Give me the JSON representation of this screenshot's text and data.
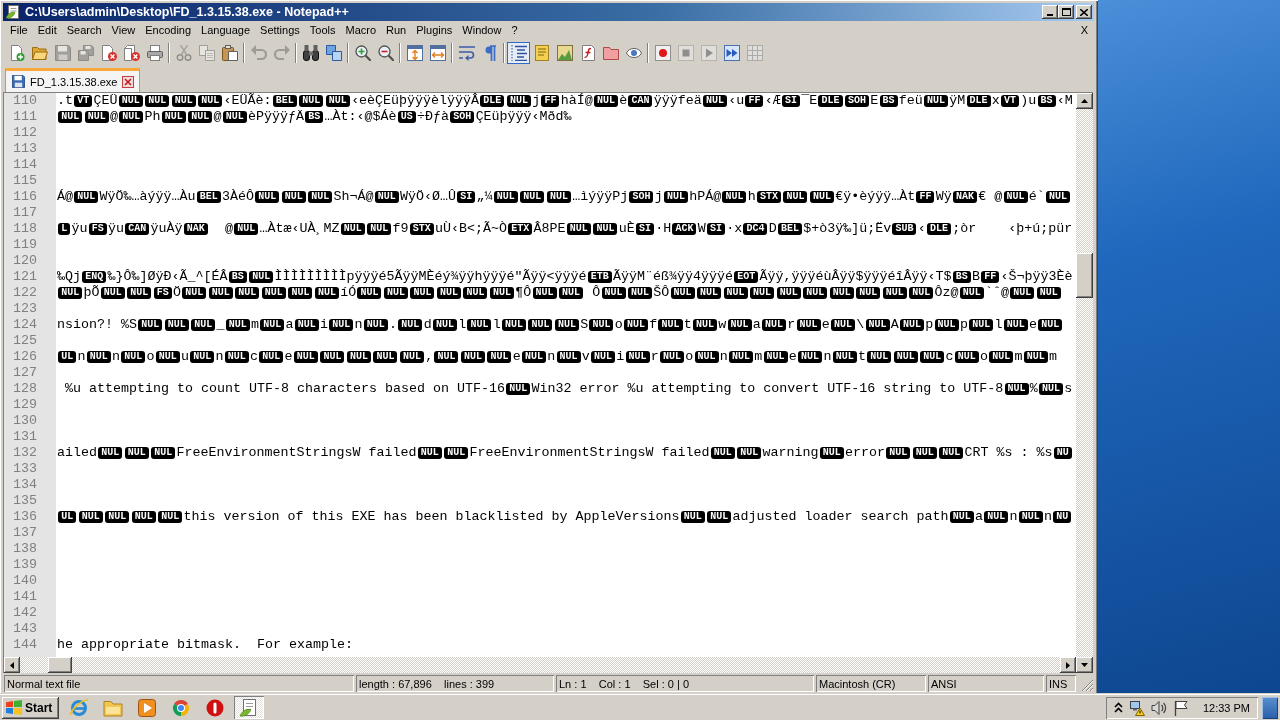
{
  "window": {
    "title": "C:\\Users\\admin\\Desktop\\FD_1.3.15.38.exe - Notepad++"
  },
  "menu": {
    "items": [
      "File",
      "Edit",
      "Search",
      "View",
      "Encoding",
      "Language",
      "Settings",
      "Tools",
      "Macro",
      "Run",
      "Plugins",
      "Window",
      "?"
    ],
    "close": "X"
  },
  "toolbar": [
    {
      "pressed": false,
      "disabled": false
    },
    {
      "pressed": false,
      "disabled": false
    },
    {
      "pressed": false,
      "disabled": true
    },
    {
      "pressed": false,
      "disabled": true
    },
    {
      "pressed": false,
      "disabled": false
    },
    {
      "pressed": false,
      "disabled": false
    },
    {
      "pressed": false,
      "disabled": false
    },
    {
      "pressed": false,
      "disabled": true
    },
    {
      "pressed": false,
      "disabled": true
    },
    {
      "pressed": false,
      "disabled": false
    },
    {
      "pressed": false,
      "disabled": true
    },
    {
      "pressed": false,
      "disabled": true
    },
    {
      "pressed": false,
      "disabled": false
    },
    {
      "pressed": false,
      "disabled": false
    },
    {
      "pressed": false,
      "disabled": false
    },
    {
      "pressed": false,
      "disabled": false
    },
    {
      "pressed": false,
      "disabled": false
    },
    {
      "pressed": false,
      "disabled": false
    },
    {
      "pressed": false,
      "disabled": false
    },
    {
      "pressed": false,
      "disabled": false
    },
    {
      "pressed": true,
      "disabled": false
    },
    {
      "pressed": false,
      "disabled": false
    },
    {
      "pressed": false,
      "disabled": false
    },
    {
      "pressed": false,
      "disabled": false
    },
    {
      "pressed": false,
      "disabled": false
    },
    {
      "pressed": false,
      "disabled": false
    },
    {
      "pressed": false,
      "disabled": false
    },
    {
      "pressed": false,
      "disabled": true
    },
    {
      "pressed": false,
      "disabled": true
    },
    {
      "pressed": false,
      "disabled": false
    },
    {
      "pressed": false,
      "disabled": true
    }
  ],
  "tabs": [
    {
      "label": "FD_1.3.15.38.exe",
      "selected": true,
      "modified": false
    }
  ],
  "editor": {
    "lines": [
      {
        "number": "110",
        "segments": [
          {
            "kind": "text",
            "text": ".t"
          },
          {
            "kind": "control",
            "text": "VT"
          },
          {
            "kind": "text",
            "text": "ÇEÜ"
          },
          {
            "kind": "control",
            "text": "NUL"
          },
          {
            "kind": "control",
            "text": "NUL"
          },
          {
            "kind": "control",
            "text": "NUL"
          },
          {
            "kind": "control",
            "text": "NUL"
          },
          {
            "kind": "text",
            "text": "‹EÜÃè:"
          },
          {
            "kind": "control",
            "text": "BEL"
          },
          {
            "kind": "control",
            "text": "NUL"
          },
          {
            "kind": "control",
            "text": "NUL"
          },
          {
            "kind": "text",
            "text": "‹eèÇEüþÿÿÿèlÿÿÿÂ"
          },
          {
            "kind": "control",
            "text": "DLE"
          },
          {
            "kind": "control",
            "text": "NUL"
          },
          {
            "kind": "text",
            "text": "j"
          },
          {
            "kind": "control",
            "text": "FF"
          },
          {
            "kind": "text",
            "text": "hàÍ@"
          },
          {
            "kind": "control",
            "text": "NUL"
          },
          {
            "kind": "text",
            "text": "è"
          },
          {
            "kind": "control",
            "text": "CAN"
          },
          {
            "kind": "text",
            "text": "ÿÿÿfeä"
          },
          {
            "kind": "control",
            "text": "NUL"
          },
          {
            "kind": "text",
            "text": "‹u"
          },
          {
            "kind": "control",
            "text": "FF"
          },
          {
            "kind": "text",
            "text": "‹Æ"
          },
          {
            "kind": "control",
            "text": "SI"
          },
          {
            "kind": "text",
            "text": "¯E"
          },
          {
            "kind": "control",
            "text": "DLE"
          },
          {
            "kind": "control",
            "text": "SOH"
          },
          {
            "kind": "text",
            "text": "E"
          },
          {
            "kind": "control",
            "text": "BS"
          },
          {
            "kind": "text",
            "text": "feü"
          },
          {
            "kind": "control",
            "text": "NUL"
          },
          {
            "kind": "text",
            "text": "ÿM"
          },
          {
            "kind": "control",
            "text": "DLE"
          },
          {
            "kind": "text",
            "text": "x"
          },
          {
            "kind": "control",
            "text": "VT"
          },
          {
            "kind": "text",
            "text": ")u"
          },
          {
            "kind": "control",
            "text": "BS"
          },
          {
            "kind": "text",
            "text": "‹M"
          }
        ]
      },
      {
        "number": "111",
        "segments": [
          {
            "kind": "control",
            "text": "NUL"
          },
          {
            "kind": "control",
            "text": "NUL"
          },
          {
            "kind": "text",
            "text": "@"
          },
          {
            "kind": "control",
            "text": "NUL"
          },
          {
            "kind": "text",
            "text": "Ph"
          },
          {
            "kind": "control",
            "text": "NUL"
          },
          {
            "kind": "control",
            "text": "NUL"
          },
          {
            "kind": "text",
            "text": "@"
          },
          {
            "kind": "control",
            "text": "NUL"
          },
          {
            "kind": "text",
            "text": "èPÿÿÿƒÄ"
          },
          {
            "kind": "control",
            "text": "BS"
          },
          {
            "kind": "text",
            "text": "…Àt:‹@$Áè"
          },
          {
            "kind": "control",
            "text": "US"
          },
          {
            "kind": "text",
            "text": "÷Ðƒà"
          },
          {
            "kind": "control",
            "text": "SOH"
          },
          {
            "kind": "text",
            "text": "ÇEüþÿÿÿ‹Mðd‰"
          }
        ]
      },
      {
        "number": "112"
      },
      {
        "number": "113"
      },
      {
        "number": "114"
      },
      {
        "number": "115"
      },
      {
        "number": "116",
        "segments": [
          {
            "kind": "text",
            "text": "Á@"
          },
          {
            "kind": "control",
            "text": "NUL"
          },
          {
            "kind": "text",
            "text": "WÿÖ‰…àýÿÿ…Àu"
          },
          {
            "kind": "control",
            "text": "BEL"
          },
          {
            "kind": "text",
            "text": "3ÀéÔ"
          },
          {
            "kind": "control",
            "text": "NUL"
          },
          {
            "kind": "control",
            "text": "NUL"
          },
          {
            "kind": "control",
            "text": "NUL"
          },
          {
            "kind": "text",
            "text": "Sh¬Á@"
          },
          {
            "kind": "control",
            "text": "NUL"
          },
          {
            "kind": "text",
            "text": "WÿÖ‹Ø…Û"
          },
          {
            "kind": "control",
            "text": "SI"
          },
          {
            "kind": "text",
            "text": "„¼"
          },
          {
            "kind": "control",
            "text": "NUL"
          },
          {
            "kind": "control",
            "text": "NUL"
          },
          {
            "kind": "control",
            "text": "NUL"
          },
          {
            "kind": "text",
            "text": "…ìýÿÿPj"
          },
          {
            "kind": "control",
            "text": "SOH"
          },
          {
            "kind": "text",
            "text": "j"
          },
          {
            "kind": "control",
            "text": "NUL"
          },
          {
            "kind": "text",
            "text": "hPÁ@"
          },
          {
            "kind": "control",
            "text": "NUL"
          },
          {
            "kind": "text",
            "text": "h"
          },
          {
            "kind": "control",
            "text": "STX"
          },
          {
            "kind": "control",
            "text": "NUL"
          },
          {
            "kind": "control",
            "text": "NUL"
          },
          {
            "kind": "text",
            "text": "€ÿ•èýÿÿ…Àt"
          },
          {
            "kind": "control",
            "text": "FF"
          },
          {
            "kind": "text",
            "text": "Wÿ"
          },
          {
            "kind": "control",
            "text": "NAK"
          },
          {
            "kind": "text",
            "text": "€ @"
          },
          {
            "kind": "control",
            "text": "NUL"
          },
          {
            "kind": "text",
            "text": "é`"
          },
          {
            "kind": "control",
            "text": "NUL"
          }
        ]
      },
      {
        "number": "117"
      },
      {
        "number": "118",
        "segments": [
          {
            "kind": "control",
            "text": "L"
          },
          {
            "kind": "text",
            "text": "ÿu"
          },
          {
            "kind": "control",
            "text": "FS"
          },
          {
            "kind": "text",
            "text": "ÿu"
          },
          {
            "kind": "control",
            "text": "CAN"
          },
          {
            "kind": "text",
            "text": "ÿuÀÿ"
          },
          {
            "kind": "control",
            "text": "NAK"
          },
          {
            "kind": "text",
            "text": "  @"
          },
          {
            "kind": "control",
            "text": "NUL"
          },
          {
            "kind": "text",
            "text": "…Àtæ‹UÀ¸MZ"
          },
          {
            "kind": "control",
            "text": "NUL"
          },
          {
            "kind": "control",
            "text": "NUL"
          },
          {
            "kind": "text",
            "text": "f9"
          },
          {
            "kind": "control",
            "text": "STX"
          },
          {
            "kind": "text",
            "text": "uÙ‹B<;Ã~Ò"
          },
          {
            "kind": "control",
            "text": "ETX"
          },
          {
            "kind": "text",
            "text": "Â8PE"
          },
          {
            "kind": "control",
            "text": "NUL"
          },
          {
            "kind": "control",
            "text": "NUL"
          },
          {
            "kind": "text",
            "text": "uÈ"
          },
          {
            "kind": "control",
            "text": "SI"
          },
          {
            "kind": "text",
            "text": "·H"
          },
          {
            "kind": "control",
            "text": "ACK"
          },
          {
            "kind": "text",
            "text": "W"
          },
          {
            "kind": "control",
            "text": "SI"
          },
          {
            "kind": "text",
            "text": "·x"
          },
          {
            "kind": "control",
            "text": "DC4"
          },
          {
            "kind": "text",
            "text": "D"
          },
          {
            "kind": "control",
            "text": "BEL"
          },
          {
            "kind": "text",
            "text": "$+ò3ÿ‰]ü;Ëv"
          },
          {
            "kind": "control",
            "text": "SUB"
          },
          {
            "kind": "text",
            "text": "‹"
          },
          {
            "kind": "control",
            "text": "DLE"
          },
          {
            "kind": "text",
            "text": ";òr    ‹þ+ú;pür"
          }
        ]
      },
      {
        "number": "119"
      },
      {
        "number": "120"
      },
      {
        "number": "121",
        "segments": [
          {
            "kind": "text",
            "text": "‰Qj"
          },
          {
            "kind": "control",
            "text": "ENQ"
          },
          {
            "kind": "text",
            "text": "‰}Ô‰]ØÿÐ‹Ã_^[ÉÂ"
          },
          {
            "kind": "control",
            "text": "BS"
          },
          {
            "kind": "control",
            "text": "NUL"
          },
          {
            "kind": "text",
            "text": "ÌÌÌÌÌÌÌÌÌpÿÿÿé5ÃÿÿMÈéý¾ÿÿhÿÿÿé\"Ãÿÿ<ÿÿÿé"
          },
          {
            "kind": "control",
            "text": "ETB"
          },
          {
            "kind": "text",
            "text": "ÃÿÿM¨éß¾ÿÿ4ÿÿÿé"
          },
          {
            "kind": "control",
            "text": "EOT"
          },
          {
            "kind": "text",
            "text": "Ãÿÿ,ÿÿÿéùÂÿÿ$ÿÿÿéîÂÿÿ‹T$"
          },
          {
            "kind": "control",
            "text": "BS"
          },
          {
            "kind": "text",
            "text": "B"
          },
          {
            "kind": "control",
            "text": "FF"
          },
          {
            "kind": "text",
            "text": "‹Š¬þÿÿ3Èè"
          }
        ]
      },
      {
        "number": "122",
        "segments": [
          {
            "kind": "control",
            "text": "NUL"
          },
          {
            "kind": "text",
            "text": "þÕ"
          },
          {
            "kind": "control",
            "text": "NUL"
          },
          {
            "kind": "control",
            "text": "NUL"
          },
          {
            "kind": "control",
            "text": "FS"
          },
          {
            "kind": "text",
            "text": "Ö"
          },
          {
            "kind": "control",
            "text": "NUL"
          },
          {
            "kind": "control",
            "text": "NUL"
          },
          {
            "kind": "control",
            "text": "NUL"
          },
          {
            "kind": "control",
            "text": "NUL"
          },
          {
            "kind": "control",
            "text": "NUL"
          },
          {
            "kind": "control",
            "text": "NUL"
          },
          {
            "kind": "text",
            "text": "íÓ"
          },
          {
            "kind": "control",
            "text": "NUL"
          },
          {
            "kind": "control",
            "text": "NUL"
          },
          {
            "kind": "control",
            "text": "NUL"
          },
          {
            "kind": "control",
            "text": "NUL"
          },
          {
            "kind": "control",
            "text": "NUL"
          },
          {
            "kind": "control",
            "text": "NUL"
          },
          {
            "kind": "text",
            "text": "¶Ô"
          },
          {
            "kind": "control",
            "text": "NUL"
          },
          {
            "kind": "control",
            "text": "NUL"
          },
          {
            "kind": "text",
            "text": " Ô"
          },
          {
            "kind": "control",
            "text": "NUL"
          },
          {
            "kind": "control",
            "text": "NUL"
          },
          {
            "kind": "text",
            "text": "ŠÔ"
          },
          {
            "kind": "control",
            "text": "NUL"
          },
          {
            "kind": "control",
            "text": "NUL"
          },
          {
            "kind": "control",
            "text": "NUL"
          },
          {
            "kind": "control",
            "text": "NUL"
          },
          {
            "kind": "control",
            "text": "NUL"
          },
          {
            "kind": "control",
            "text": "NUL"
          },
          {
            "kind": "control",
            "text": "NUL"
          },
          {
            "kind": "control",
            "text": "NUL"
          },
          {
            "kind": "control",
            "text": "NUL"
          },
          {
            "kind": "control",
            "text": "NUL"
          },
          {
            "kind": "text",
            "text": "Ôz@"
          },
          {
            "kind": "control",
            "text": "NUL"
          },
          {
            "kind": "text",
            "text": "`ˆ@"
          },
          {
            "kind": "control",
            "text": "NUL"
          },
          {
            "kind": "control",
            "text": "NUL"
          }
        ]
      },
      {
        "number": "123"
      },
      {
        "number": "124",
        "segments": [
          {
            "kind": "text",
            "text": "nsion?! %S"
          },
          {
            "kind": "control",
            "text": "NUL"
          },
          {
            "kind": "control",
            "text": "NUL"
          },
          {
            "kind": "control",
            "text": "NUL"
          },
          {
            "kind": "text",
            "text": "_"
          },
          {
            "kind": "control",
            "text": "NUL"
          },
          {
            "kind": "text",
            "text": "m"
          },
          {
            "kind": "control",
            "text": "NUL"
          },
          {
            "kind": "text",
            "text": "a"
          },
          {
            "kind": "control",
            "text": "NUL"
          },
          {
            "kind": "text",
            "text": "i"
          },
          {
            "kind": "control",
            "text": "NUL"
          },
          {
            "kind": "text",
            "text": "n"
          },
          {
            "kind": "control",
            "text": "NUL"
          },
          {
            "kind": "text",
            "text": "."
          },
          {
            "kind": "control",
            "text": "NUL"
          },
          {
            "kind": "text",
            "text": "d"
          },
          {
            "kind": "control",
            "text": "NUL"
          },
          {
            "kind": "text",
            "text": "l"
          },
          {
            "kind": "control",
            "text": "NUL"
          },
          {
            "kind": "text",
            "text": "l"
          },
          {
            "kind": "control",
            "text": "NUL"
          },
          {
            "kind": "control",
            "text": "NUL"
          },
          {
            "kind": "control",
            "text": "NUL"
          },
          {
            "kind": "text",
            "text": "S"
          },
          {
            "kind": "control",
            "text": "NUL"
          },
          {
            "kind": "text",
            "text": "o"
          },
          {
            "kind": "control",
            "text": "NUL"
          },
          {
            "kind": "text",
            "text": "f"
          },
          {
            "kind": "control",
            "text": "NUL"
          },
          {
            "kind": "text",
            "text": "t"
          },
          {
            "kind": "control",
            "text": "NUL"
          },
          {
            "kind": "text",
            "text": "w"
          },
          {
            "kind": "control",
            "text": "NUL"
          },
          {
            "kind": "text",
            "text": "a"
          },
          {
            "kind": "control",
            "text": "NUL"
          },
          {
            "kind": "text",
            "text": "r"
          },
          {
            "kind": "control",
            "text": "NUL"
          },
          {
            "kind": "text",
            "text": "e"
          },
          {
            "kind": "control",
            "text": "NUL"
          },
          {
            "kind": "text",
            "text": "\\"
          },
          {
            "kind": "control",
            "text": "NUL"
          },
          {
            "kind": "text",
            "text": "A"
          },
          {
            "kind": "control",
            "text": "NUL"
          },
          {
            "kind": "text",
            "text": "p"
          },
          {
            "kind": "control",
            "text": "NUL"
          },
          {
            "kind": "text",
            "text": "p"
          },
          {
            "kind": "control",
            "text": "NUL"
          },
          {
            "kind": "text",
            "text": "l"
          },
          {
            "kind": "control",
            "text": "NUL"
          },
          {
            "kind": "text",
            "text": "e"
          },
          {
            "kind": "control",
            "text": "NUL"
          }
        ]
      },
      {
        "number": "125"
      },
      {
        "number": "126",
        "segments": [
          {
            "kind": "control",
            "text": "UL"
          },
          {
            "kind": "text",
            "text": "n"
          },
          {
            "kind": "control",
            "text": "NUL"
          },
          {
            "kind": "text",
            "text": "n"
          },
          {
            "kind": "control",
            "text": "NUL"
          },
          {
            "kind": "text",
            "text": "o"
          },
          {
            "kind": "control",
            "text": "NUL"
          },
          {
            "kind": "text",
            "text": "u"
          },
          {
            "kind": "control",
            "text": "NUL"
          },
          {
            "kind": "text",
            "text": "n"
          },
          {
            "kind": "control",
            "text": "NUL"
          },
          {
            "kind": "text",
            "text": "c"
          },
          {
            "kind": "control",
            "text": "NUL"
          },
          {
            "kind": "text",
            "text": "e"
          },
          {
            "kind": "control",
            "text": "NUL"
          },
          {
            "kind": "control",
            "text": "NUL"
          },
          {
            "kind": "control",
            "text": "NUL"
          },
          {
            "kind": "control",
            "text": "NUL"
          },
          {
            "kind": "control",
            "text": "NUL"
          },
          {
            "kind": "text",
            "text": ","
          },
          {
            "kind": "control",
            "text": "NUL"
          },
          {
            "kind": "control",
            "text": "NUL"
          },
          {
            "kind": "control",
            "text": "NUL"
          },
          {
            "kind": "text",
            "text": "e"
          },
          {
            "kind": "control",
            "text": "NUL"
          },
          {
            "kind": "text",
            "text": "n"
          },
          {
            "kind": "control",
            "text": "NUL"
          },
          {
            "kind": "text",
            "text": "v"
          },
          {
            "kind": "control",
            "text": "NUL"
          },
          {
            "kind": "text",
            "text": "i"
          },
          {
            "kind": "control",
            "text": "NUL"
          },
          {
            "kind": "text",
            "text": "r"
          },
          {
            "kind": "control",
            "text": "NUL"
          },
          {
            "kind": "text",
            "text": "o"
          },
          {
            "kind": "control",
            "text": "NUL"
          },
          {
            "kind": "text",
            "text": "n"
          },
          {
            "kind": "control",
            "text": "NUL"
          },
          {
            "kind": "text",
            "text": "m"
          },
          {
            "kind": "control",
            "text": "NUL"
          },
          {
            "kind": "text",
            "text": "e"
          },
          {
            "kind": "control",
            "text": "NUL"
          },
          {
            "kind": "text",
            "text": "n"
          },
          {
            "kind": "control",
            "text": "NUL"
          },
          {
            "kind": "text",
            "text": "t"
          },
          {
            "kind": "control",
            "text": "NUL"
          },
          {
            "kind": "control",
            "text": "NUL"
          },
          {
            "kind": "control",
            "text": "NUL"
          },
          {
            "kind": "text",
            "text": "c"
          },
          {
            "kind": "control",
            "text": "NUL"
          },
          {
            "kind": "text",
            "text": "o"
          },
          {
            "kind": "control",
            "text": "NUL"
          },
          {
            "kind": "text",
            "text": "m"
          },
          {
            "kind": "control",
            "text": "NUL"
          },
          {
            "kind": "text",
            "text": "m"
          }
        ]
      },
      {
        "number": "127"
      },
      {
        "number": "128",
        "segments": [
          {
            "kind": "text",
            "text": " %u attempting to count UTF-8 characters based on UTF-16"
          },
          {
            "kind": "control",
            "text": "NUL"
          },
          {
            "kind": "text",
            "text": "Win32 error %u attempting to convert UTF-16 string to UTF-8"
          },
          {
            "kind": "control",
            "text": "NUL"
          },
          {
            "kind": "text",
            "text": "%"
          },
          {
            "kind": "control",
            "text": "NUL"
          },
          {
            "kind": "text",
            "text": "s"
          }
        ]
      },
      {
        "number": "129"
      },
      {
        "number": "130"
      },
      {
        "number": "131"
      },
      {
        "number": "132",
        "segments": [
          {
            "kind": "text",
            "text": "ailed"
          },
          {
            "kind": "control",
            "text": "NUL"
          },
          {
            "kind": "control",
            "text": "NUL"
          },
          {
            "kind": "control",
            "text": "NUL"
          },
          {
            "kind": "text",
            "text": "FreeEnvironmentStringsW failed"
          },
          {
            "kind": "control",
            "text": "NUL"
          },
          {
            "kind": "control",
            "text": "NUL"
          },
          {
            "kind": "text",
            "text": "FreeEnvironmentStringsW failed"
          },
          {
            "kind": "control",
            "text": "NUL"
          },
          {
            "kind": "control",
            "text": "NUL"
          },
          {
            "kind": "text",
            "text": "warning"
          },
          {
            "kind": "control",
            "text": "NUL"
          },
          {
            "kind": "text",
            "text": "error"
          },
          {
            "kind": "control",
            "text": "NUL"
          },
          {
            "kind": "control",
            "text": "NUL"
          },
          {
            "kind": "control",
            "text": "NUL"
          },
          {
            "kind": "text",
            "text": "CRT %s : %s"
          },
          {
            "kind": "control",
            "text": "NU"
          }
        ]
      },
      {
        "number": "133"
      },
      {
        "number": "134"
      },
      {
        "number": "135"
      },
      {
        "number": "136",
        "segments": [
          {
            "kind": "control",
            "text": "UL"
          },
          {
            "kind": "control",
            "text": "NUL"
          },
          {
            "kind": "control",
            "text": "NUL"
          },
          {
            "kind": "control",
            "text": "NUL"
          },
          {
            "kind": "control",
            "text": "NUL"
          },
          {
            "kind": "text",
            "text": "this version of this EXE has been blacklisted by AppleVersions"
          },
          {
            "kind": "control",
            "text": "NUL"
          },
          {
            "kind": "control",
            "text": "NUL"
          },
          {
            "kind": "text",
            "text": "adjusted loader search path"
          },
          {
            "kind": "control",
            "text": "NUL"
          },
          {
            "kind": "text",
            "text": "a"
          },
          {
            "kind": "control",
            "text": "NUL"
          },
          {
            "kind": "text",
            "text": "n"
          },
          {
            "kind": "control",
            "text": "NUL"
          },
          {
            "kind": "text",
            "text": "n"
          },
          {
            "kind": "control",
            "text": "NU"
          }
        ]
      },
      {
        "number": "137"
      },
      {
        "number": "138"
      },
      {
        "number": "139"
      },
      {
        "number": "140"
      },
      {
        "number": "141"
      },
      {
        "number": "142"
      },
      {
        "number": "143"
      },
      {
        "number": "144",
        "segments": [
          {
            "kind": "text",
            "text": "he appropriate bitmask.  For example:"
          }
        ]
      }
    ]
  },
  "status_bar": {
    "doc_type": "Normal text file",
    "size": "length : 67,896    lines : 399",
    "position": "Ln : 1    Col : 1    Sel : 0 | 0",
    "eol": "Macintosh (CR)",
    "encoding": "ANSI",
    "mode": "INS"
  },
  "taskbar": {
    "start": "Start",
    "apps": [
      {
        "selected": false
      },
      {
        "selected": false
      },
      {
        "selected": false
      },
      {
        "selected": false
      },
      {
        "selected": false
      },
      {
        "selected": true
      }
    ],
    "clock": "12:33 PM"
  }
}
